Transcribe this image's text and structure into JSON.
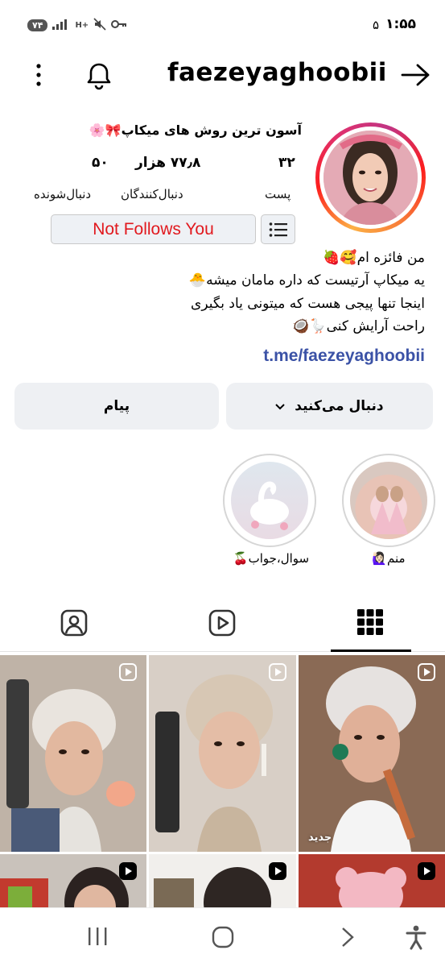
{
  "status_bar": {
    "time": "۱:۵۵",
    "notification_count": "۵",
    "battery": "۷۴",
    "network": "H+"
  },
  "header": {
    "username": "faezeyaghoobii"
  },
  "profile": {
    "display_name": "آسون ترین روش های میکاپ🎀🌸",
    "stats": [
      {
        "value": "۳۲",
        "label": "پست"
      },
      {
        "value": "۷۷٫۸ هزار",
        "label": "دنبال‌کنندگان"
      },
      {
        "value": "۵۰",
        "label": "دنبال‌شونده"
      }
    ],
    "follow_status": "Not Follows You",
    "bio": [
      "من فائزه ام🥰🍓",
      "یه میکاپ آرتیست که داره مامان میشه🐣",
      "اینجا تنها پیجی هست که میتونی یاد بگیری",
      "راحت آرایش کنی🪿🥥"
    ],
    "link": "t.me/faezeyaghoobii"
  },
  "actions": {
    "following_label": "دنبال می‌کنید",
    "message_label": "پیام"
  },
  "highlights": [
    {
      "label": "منم🙋🏻‍♀️"
    },
    {
      "label": "سوال،جواب🍒"
    }
  ],
  "grid": {
    "new_badge": "جدید"
  },
  "colors": {
    "follow_status_text": "#e1191e",
    "link": "#3b52a6",
    "button_bg": "#eef0f3"
  }
}
